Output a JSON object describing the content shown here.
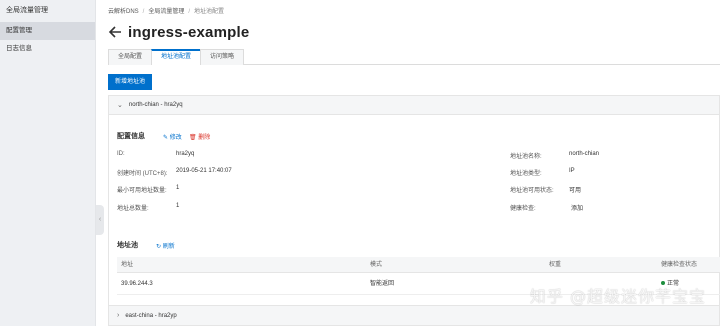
{
  "sidebar": {
    "title": "全局流量管理",
    "items": [
      {
        "label": "配置管理",
        "active": true
      },
      {
        "label": "日志信息",
        "active": false
      }
    ]
  },
  "breadcrumb": [
    "云解析DNS",
    "全局流量管理",
    "地址池配置"
  ],
  "page_title": "ingress-example",
  "tabs": [
    {
      "label": "全局配置",
      "active": false
    },
    {
      "label": "地址池配置",
      "active": true
    },
    {
      "label": "访问策略",
      "active": false
    }
  ],
  "new_pool_button": "新增地址池",
  "pool": {
    "header": "north-chian - hra2yq",
    "config_title": "配置信息",
    "edit_label": "修改",
    "delete_label": "删除",
    "left_fields": [
      {
        "label": "ID:",
        "value": "hra2yq"
      },
      {
        "label": "创建时间 (UTC+8):",
        "value": "2019-05-21 17:40:07"
      },
      {
        "label": "最小可用地址数量:",
        "value": "1"
      },
      {
        "label": "地址总数量:",
        "value": "1"
      }
    ],
    "right_fields": [
      {
        "label": "地址池名称:",
        "value": "north-chian"
      },
      {
        "label": "地址池类型:",
        "value": "IP"
      },
      {
        "label": "地址池可用状态:",
        "value": "可用"
      },
      {
        "label": "健康检查:",
        "value": "添加"
      }
    ],
    "address_title": "地址池",
    "refresh_label": "刷新",
    "table": {
      "columns": [
        "地址",
        "模式",
        "权重",
        "健康检查状态"
      ],
      "rows": [
        {
          "address": "39.96.244.3",
          "mode": "智能返回",
          "weight": "",
          "health": "正常"
        }
      ]
    }
  },
  "pool2": {
    "header": "east-china - hra2yp"
  },
  "watermark": "知乎 @超级迷你芊宝宝",
  "colors": {
    "accent": "#0070cc",
    "danger": "#d93026",
    "ok": "#1e8e3e"
  }
}
